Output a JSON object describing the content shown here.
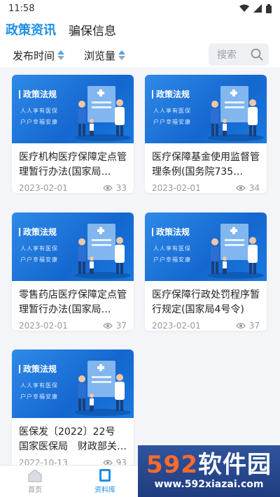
{
  "status": {
    "time": "11:58"
  },
  "tabs": [
    {
      "label": "政策资讯",
      "active": true
    },
    {
      "label": "骗保信息",
      "active": false
    }
  ],
  "filters": {
    "sort_publish": "发布时间",
    "sort_views": "浏览量",
    "search_placeholder": "搜索"
  },
  "banner": {
    "title": "政策法规",
    "line1": "人人享有医保",
    "line2": "户户幸福安康"
  },
  "cards": [
    {
      "title": "医疗机构医疗保障定点管理暂行办法(国家局…",
      "date": "2023-02-01",
      "views": "33"
    },
    {
      "title": "医疗保障基金使用监督管理条例(国务院735…",
      "date": "2023-02-01",
      "views": "34"
    },
    {
      "title": "零售药店医疗保障定点管理暂行办法(国家局…",
      "date": "2023-02-01",
      "views": "37"
    },
    {
      "title": "医疗保障行政处罚程序暂行规定(国家局4号令)",
      "date": "2023-02-01",
      "views": "37"
    },
    {
      "title": "医保发〔2022〕22号 国家医保局　财政部关…",
      "date": "2022-10-13",
      "views": "93"
    }
  ],
  "nav": {
    "home": "首页",
    "library": "资料库"
  },
  "watermark": {
    "brand_num": "592",
    "brand_text": "软件园",
    "url": "www.592xiazai.com"
  },
  "colors": {
    "accent": "#1e8fe6",
    "banner": "#1a74dc"
  }
}
